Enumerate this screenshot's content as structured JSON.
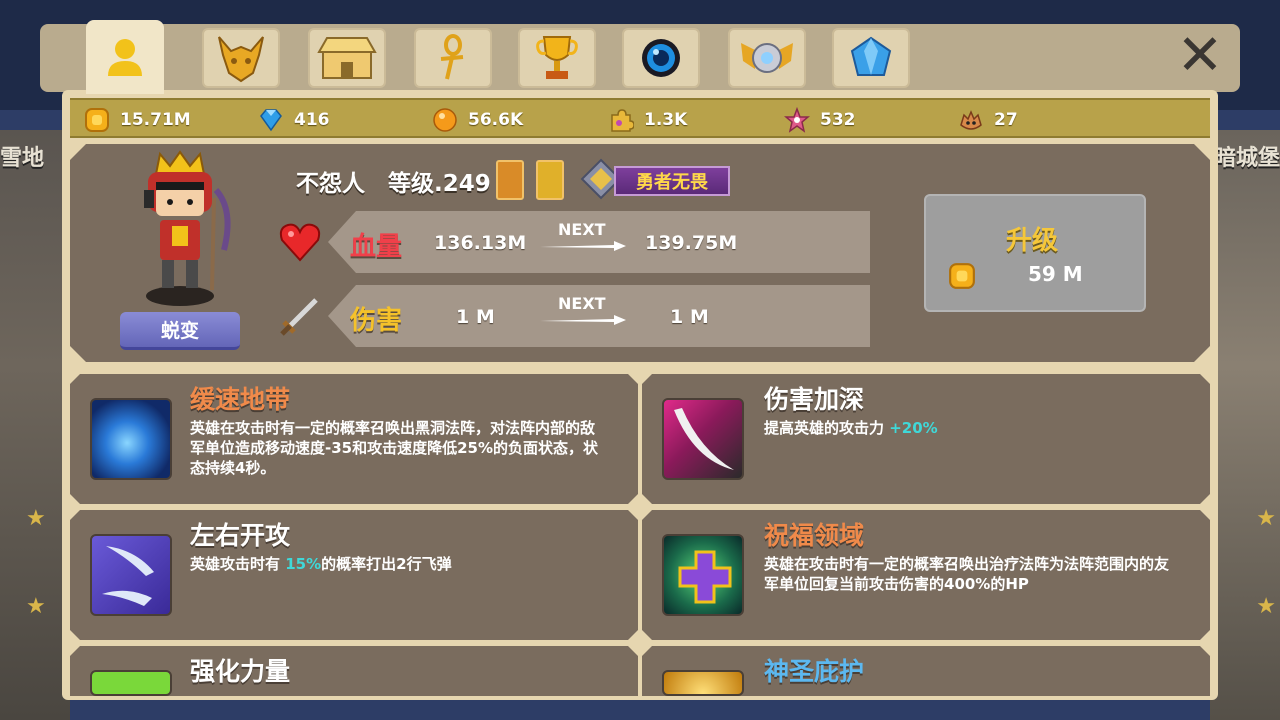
{
  "background": {
    "left_label": "雪地",
    "right_label": "暗城堡"
  },
  "tabs": [
    {
      "name": "hero-tab",
      "icon": "hero-icon",
      "active": true
    },
    {
      "name": "mount-tab",
      "icon": "horned-helmet-icon",
      "active": false
    },
    {
      "name": "shop-tab",
      "icon": "shop-icon",
      "active": false
    },
    {
      "name": "ankh-tab",
      "icon": "ankh-icon",
      "active": false
    },
    {
      "name": "trophy-tab",
      "icon": "trophy-icon",
      "active": false
    },
    {
      "name": "orb-tab",
      "icon": "blue-orb-icon",
      "active": false
    },
    {
      "name": "emblem-tab",
      "icon": "winged-emblem-icon",
      "active": false
    },
    {
      "name": "gem-tab",
      "icon": "blue-gem-icon",
      "active": false
    }
  ],
  "currencies": [
    {
      "icon": "gold-coin-icon",
      "value": "15.71M"
    },
    {
      "icon": "diamond-icon",
      "value": "416"
    },
    {
      "icon": "orange-orb-icon",
      "value": "56.6K"
    },
    {
      "icon": "puzzle-piece-icon",
      "value": "1.3K"
    },
    {
      "icon": "star-fragment-icon",
      "value": "532"
    },
    {
      "icon": "beast-icon",
      "value": "27"
    }
  ],
  "hero": {
    "name": "不怨人",
    "level": "等级.249",
    "evolve_label": "蜕变",
    "title_badge": "勇者无畏"
  },
  "stats": {
    "hp": {
      "label": "血量",
      "current": "136.13M",
      "next_label": "NEXT",
      "next": "139.75M"
    },
    "damage": {
      "label": "伤害",
      "current": "1 M",
      "next_label": "NEXT",
      "next": "1 M"
    }
  },
  "upgrade": {
    "label": "升级",
    "cost": "59 M"
  },
  "skills": [
    {
      "name": "缓速地带",
      "name_color": "#f08a4a",
      "desc_parts": [
        "英雄在攻击时有一定的概率召唤出黑洞法阵，对法阵内部的敌军单位造成移动速度-35和攻击速度降低25%的负面状态，状态持续4秒。"
      ],
      "icon": "blue-vortex-icon"
    },
    {
      "name": "伤害加深",
      "name_color": "#ffffff",
      "desc_pre": "提高英雄的攻击力 ",
      "desc_hl": "+20%",
      "desc_post": "",
      "icon": "blade-slash-icon"
    },
    {
      "name": "左右开攻",
      "name_color": "#ffffff",
      "desc_pre": "英雄攻击时有 ",
      "desc_hl": "15%",
      "desc_post": "的概率打出2行飞弹",
      "icon": "twin-daggers-icon"
    },
    {
      "name": "祝福领域",
      "name_color": "#f08a4a",
      "desc_parts": [
        "英雄在攻击时有一定的概率召唤出治疗法阵为法阵范围内的友军单位回复当前攻击伤害的400%的HP"
      ],
      "icon": "healing-cross-icon"
    },
    {
      "name": "强化力量",
      "name_color": "#ffffff",
      "icon": "green-fist-icon"
    },
    {
      "name": "神圣庇护",
      "name_color": "#5cb8f0",
      "icon": "golden-halo-icon"
    }
  ]
}
